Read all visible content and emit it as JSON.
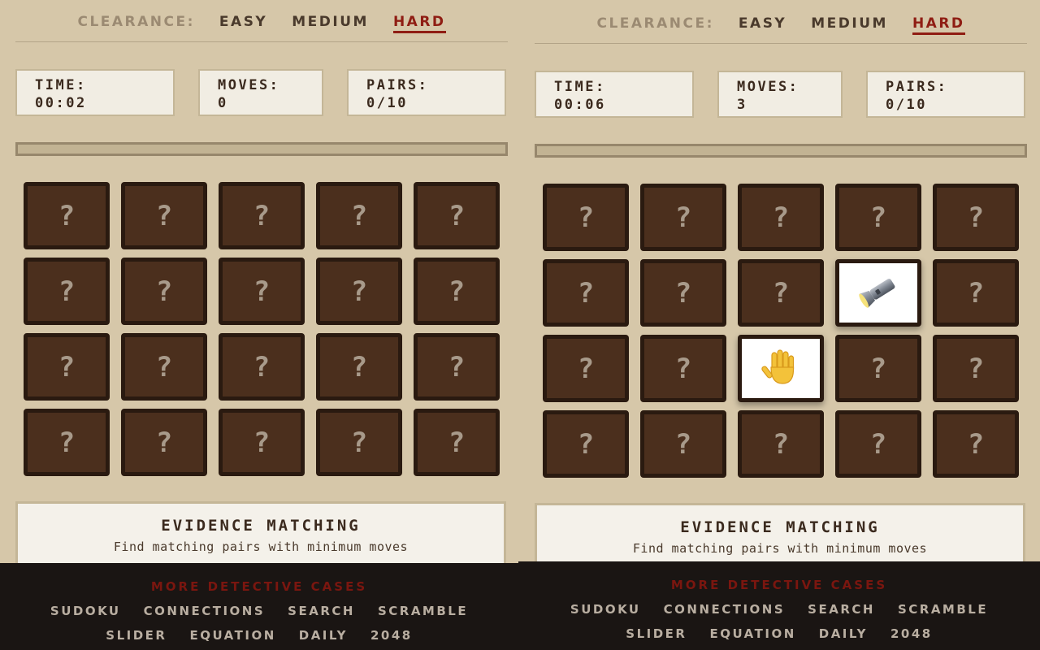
{
  "left": {
    "clearance": {
      "label": "CLEARANCE:",
      "easy": "EASY",
      "medium": "MEDIUM",
      "hard": "HARD",
      "active": "hard"
    },
    "stats": {
      "time_label": "TIME:",
      "time_value": "00:02",
      "moves_label": "MOVES:",
      "moves_value": "0",
      "pairs_label": "PAIRS:",
      "pairs_value": "0/10"
    },
    "progress_fraction": 0,
    "cards": [
      "?",
      "?",
      "?",
      "?",
      "?",
      "?",
      "?",
      "?",
      "?",
      "?",
      "?",
      "?",
      "?",
      "?",
      "?",
      "?",
      "?",
      "?",
      "?",
      "?"
    ],
    "info": {
      "title": "EVIDENCE MATCHING",
      "subtitle": "Find matching pairs with minimum moves"
    },
    "footer": {
      "heading": "MORE DETECTIVE CASES",
      "links": [
        "SUDOKU",
        "CONNECTIONS",
        "SEARCH",
        "SCRAMBLE",
        "SLIDER",
        "EQUATION",
        "DAILY",
        "2048"
      ]
    }
  },
  "right": {
    "clearance": {
      "label": "CLEARANCE:",
      "easy": "EASY",
      "medium": "MEDIUM",
      "hard": "HARD",
      "active": "hard"
    },
    "stats": {
      "time_label": "TIME:",
      "time_value": "00:06",
      "moves_label": "MOVES:",
      "moves_value": "3",
      "pairs_label": "PAIRS:",
      "pairs_value": "0/10"
    },
    "progress_fraction": 0,
    "cards": [
      "?",
      "?",
      "?",
      "?",
      "?",
      "?",
      "?",
      "?",
      "flashlight-icon",
      "?",
      "?",
      "?",
      "hand-icon",
      "?",
      "?",
      "?",
      "?",
      "?",
      "?",
      "?"
    ],
    "info": {
      "title": "EVIDENCE MATCHING",
      "subtitle": "Find matching pairs with minimum moves"
    },
    "footer": {
      "heading": "MORE DETECTIVE CASES",
      "links": [
        "SUDOKU",
        "CONNECTIONS",
        "SEARCH",
        "SCRAMBLE",
        "SLIDER",
        "EQUATION",
        "DAILY",
        "2048"
      ]
    }
  },
  "colors": {
    "background": "#d6c7a9",
    "accent": "#8f1d13",
    "card_back": "#4b2f1d",
    "card_border": "#2a1a10",
    "footer_bg": "#1a1513"
  }
}
